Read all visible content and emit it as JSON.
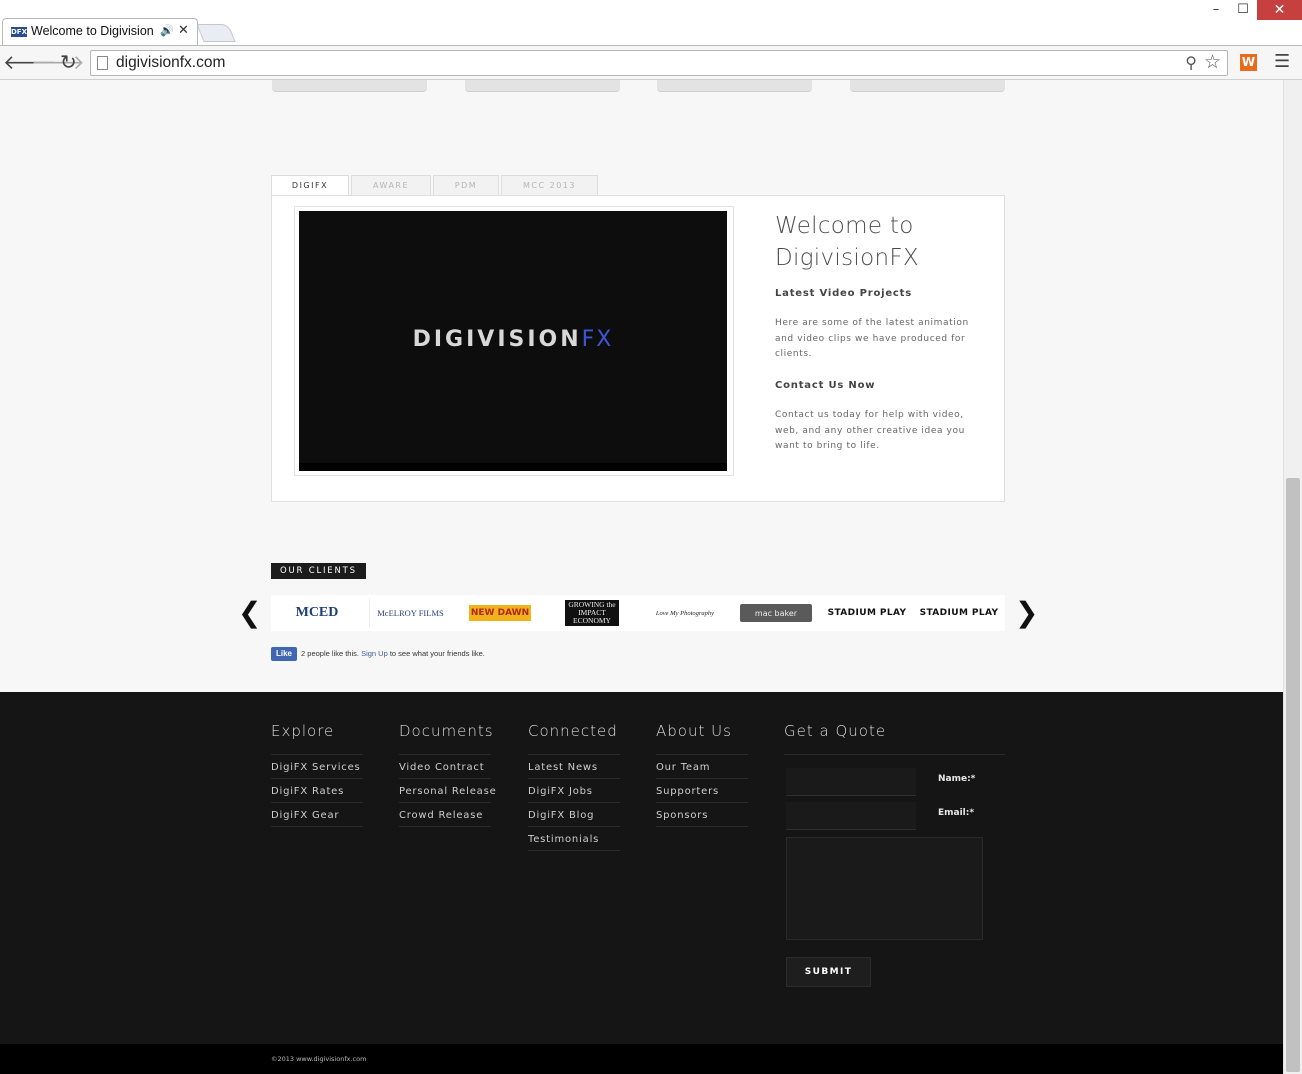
{
  "browser": {
    "tab_title": "Welcome to Digivision",
    "tab_favicon_text": "DFX",
    "url": "digivisionfx.com",
    "window_controls": {
      "minimize": "–",
      "maximize": "☐",
      "close": "✕"
    }
  },
  "page": {
    "tabs": [
      {
        "label": "DIGIFX",
        "active": true
      },
      {
        "label": "AWARE",
        "active": false
      },
      {
        "label": "PDM",
        "active": false
      },
      {
        "label": "MCC 2013",
        "active": false
      }
    ],
    "video_logo": {
      "main": "DIGIVISION",
      "accent": "FX"
    },
    "welcome_title": "Welcome to DigivisionFX",
    "section1_heading": "Latest Video Projects",
    "section1_text": "Here are some of the latest animation and video clips we have produced for clients.",
    "section2_heading": "Contact Us Now",
    "section2_text": "Contact us today for help with video, web, and any other creative idea you want to bring to life."
  },
  "clients": {
    "label": "OUR CLIENTS",
    "prev_arrow": "❮",
    "next_arrow": "❯",
    "logos": [
      {
        "name": "MCED",
        "text": "MCED"
      },
      {
        "name": "McElroy Films",
        "text": "McELROY FILMS"
      },
      {
        "name": "New Dawn",
        "text": "NEW DAWN"
      },
      {
        "name": "Growing the Impact Economy",
        "text": "GROWING the IMPACT ECONOMY"
      },
      {
        "name": "script logo",
        "text": "Love My Photography"
      },
      {
        "name": "Mac Baker",
        "text": "mac baker"
      },
      {
        "name": "Stadium Play 1",
        "text": "STADIUM PLAY"
      },
      {
        "name": "Stadium Play 2",
        "text": "STADIUM PLAY"
      }
    ]
  },
  "facebook": {
    "like_label": "Like",
    "text_before": "2 people like this.",
    "signup_link": "Sign Up",
    "text_after": "to see what your friends like."
  },
  "footer": {
    "columns": [
      {
        "heading": "Explore",
        "links": [
          "DigiFX Services",
          "DigiFX Rates",
          "DigiFX Gear"
        ]
      },
      {
        "heading": "Documents",
        "links": [
          "Video Contract",
          "Personal Release",
          "Crowd Release"
        ]
      },
      {
        "heading": "Connected",
        "links": [
          "Latest News",
          "DigiFX Jobs",
          "DigiFX Blog",
          "Testimonials"
        ]
      },
      {
        "heading": "About Us",
        "links": [
          "Our Team",
          "Supporters",
          "Sponsors"
        ]
      }
    ],
    "quote": {
      "heading": "Get a Quote",
      "name_label": "Name:*",
      "email_label": "Email:*",
      "submit_label": "SUBMIT"
    },
    "copyright": "©2013 www.digivisionfx.com"
  }
}
